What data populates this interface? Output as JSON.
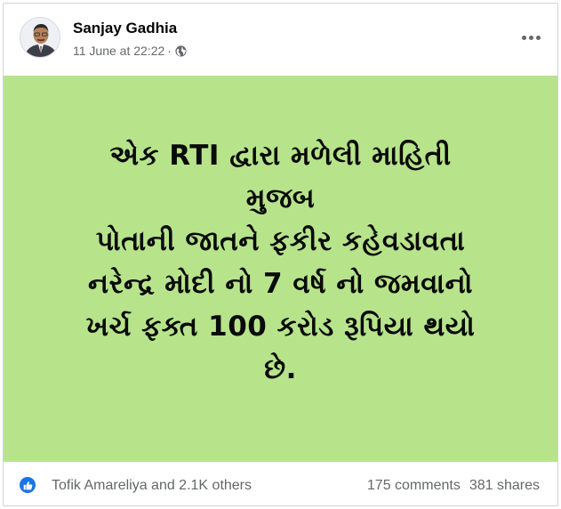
{
  "post": {
    "author": "Sanjay Gadhia",
    "timestamp": "11 June at 22:22",
    "separator": "·",
    "privacy_icon": "globe-icon",
    "more_icon": "more-options-icon",
    "background_color": "#b7e48b",
    "body_lines": [
      "એક RTI દ્વારા મળેલી માહિતી",
      "મુજબ",
      "પોતાની જાતને ફકીર કહેવડાવતા",
      "નરેન્દ્ર મોદી નો 7 વર્ષ નો જમવાનો",
      "ખર્ચ ફક્ત 100 કરોડ રૂપિયા થયો",
      "છે."
    ]
  },
  "footer": {
    "like_icon": "like-thumb-icon",
    "like_color": "#1b74e4",
    "reactions_text": "Tofik Amareliya and 2.1K others",
    "comments_text": "175 comments",
    "shares_text": "381 shares"
  }
}
